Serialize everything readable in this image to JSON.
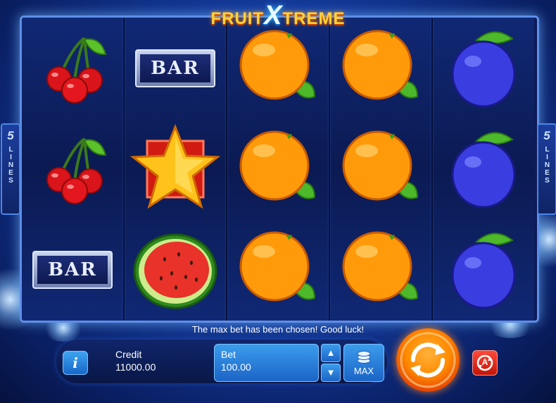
{
  "game": {
    "logo": {
      "part1": "FRUIT",
      "part2": "X",
      "part3": "TREME"
    },
    "lines_left": {
      "number": "5",
      "word": "LINES"
    },
    "lines_right": {
      "number": "5",
      "word": "LINES"
    },
    "reels": [
      [
        "cherry",
        "cherry",
        "bar"
      ],
      [
        "bar",
        "star",
        "watermelon"
      ],
      [
        "orange",
        "orange",
        "orange"
      ],
      [
        "orange",
        "orange",
        "orange"
      ],
      [
        "plum",
        "plum",
        "plum"
      ]
    ],
    "bar_text": "BAR"
  },
  "status": {
    "message": "The max bet has been chosen! Good luck!"
  },
  "controls": {
    "info_label": "i",
    "credit_label": "Credit",
    "credit_value": "11000.00",
    "bet_label": "Bet",
    "bet_value": "100.00",
    "bet_up_label": "▲",
    "bet_down_label": "▼",
    "max_label": "MAX",
    "auto_label": "A"
  },
  "colors": {
    "accent": "#1b64c6",
    "spin": "#ff8a00",
    "auto": "#c21408"
  }
}
